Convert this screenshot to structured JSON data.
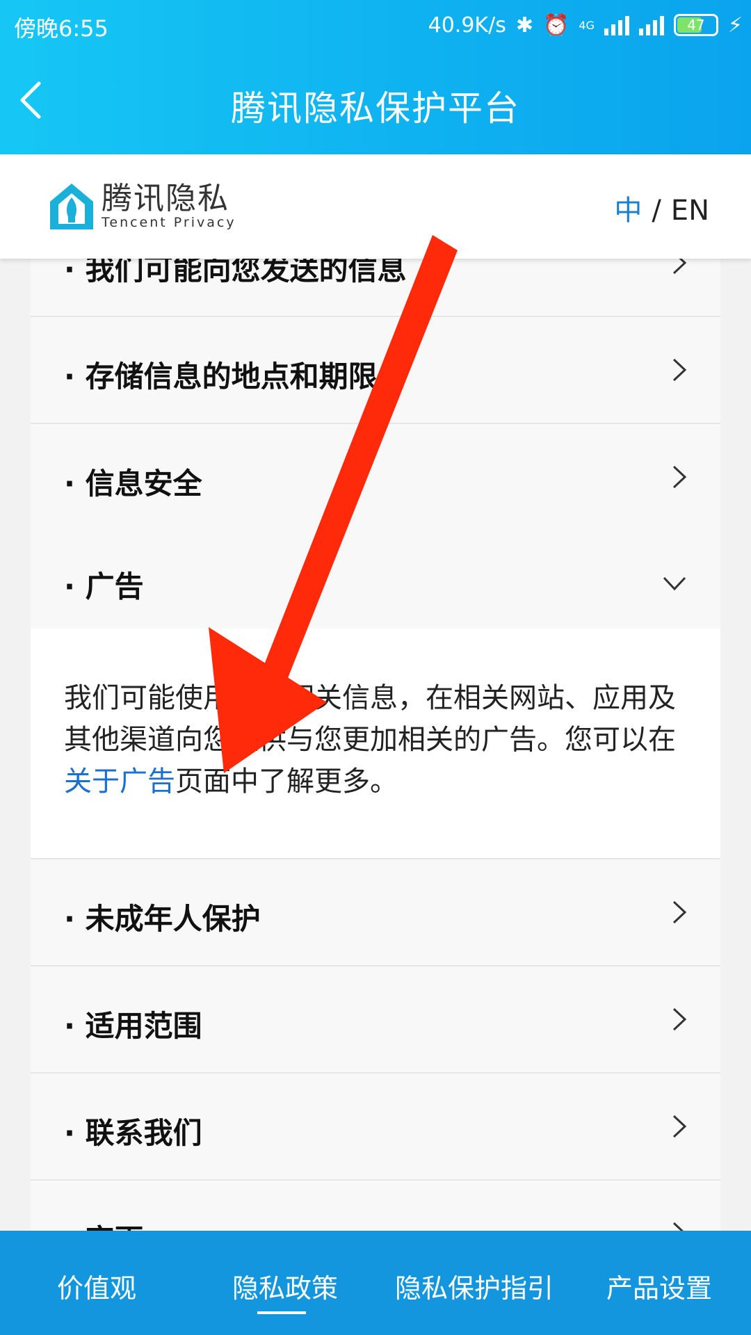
{
  "status_bar": {
    "time": "傍晚6:55",
    "net_speed": "40.9K/s",
    "network_label": "4G",
    "battery": "47"
  },
  "titlebar": {
    "title": "腾讯隐私保护平台"
  },
  "brand": {
    "logo_cn": "腾讯隐私",
    "logo_en": "Tencent Privacy",
    "lang_zh": "中",
    "lang_sep": "/",
    "lang_en": "EN"
  },
  "sections": [
    {
      "label": "我们可能向您发送的信息"
    },
    {
      "label": "存储信息的地点和期限"
    },
    {
      "label": "信息安全"
    },
    {
      "label": "广告"
    },
    {
      "label": "未成年人保护"
    },
    {
      "label": "适用范围"
    },
    {
      "label": "联系我们"
    },
    {
      "label": "变更"
    }
  ],
  "ad_section": {
    "text_before": "我们可能使用您的相关信息，在相关网站、应用及其他渠道向您提供与您更加相关的广告。您可以在",
    "link": "关于广告",
    "text_after": "页面中了解更多。"
  },
  "bottom_nav": {
    "tabs": [
      "价值观",
      "隐私政策",
      "隐私保护指引",
      "产品设置"
    ],
    "active": "隐私政策"
  },
  "colors": {
    "header_blue": "#0fb2f0",
    "link_blue": "#1a6fd0",
    "nav_blue": "#1396dd",
    "annotation_red": "#ff2a0a"
  }
}
